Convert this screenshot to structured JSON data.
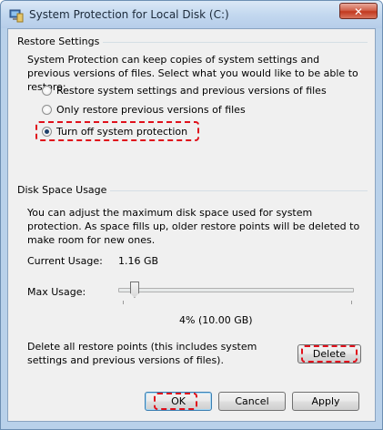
{
  "window": {
    "title": "System Protection for Local Disk (C:)",
    "close_label": "✕"
  },
  "restore_settings": {
    "group_title": "Restore Settings",
    "description": "System Protection can keep copies of system settings and previous versions of files. Select what you would like to be able to restore:",
    "options": [
      {
        "label": "Restore system settings and previous versions of files",
        "selected": false
      },
      {
        "label": "Only restore previous versions of files",
        "selected": false
      },
      {
        "label": "Turn off system protection",
        "selected": true
      }
    ]
  },
  "disk_space": {
    "group_title": "Disk Space Usage",
    "description": "You can adjust the maximum disk space used for system protection. As space fills up, older restore points will be deleted to make room for new ones.",
    "current_usage_label": "Current Usage:",
    "current_usage_value": "1.16 GB",
    "max_usage_label": "Max Usage:",
    "max_usage_fraction": 0.04,
    "max_usage_value": "4% (10.00 GB)",
    "delete_text": "Delete all restore points (this includes system settings and previous versions of files).",
    "delete_button": "Delete"
  },
  "footer": {
    "ok": "OK",
    "cancel": "Cancel",
    "apply": "Apply"
  },
  "colors": {
    "highlight": "#e0101b",
    "titlebar": "#c3d8ef"
  }
}
